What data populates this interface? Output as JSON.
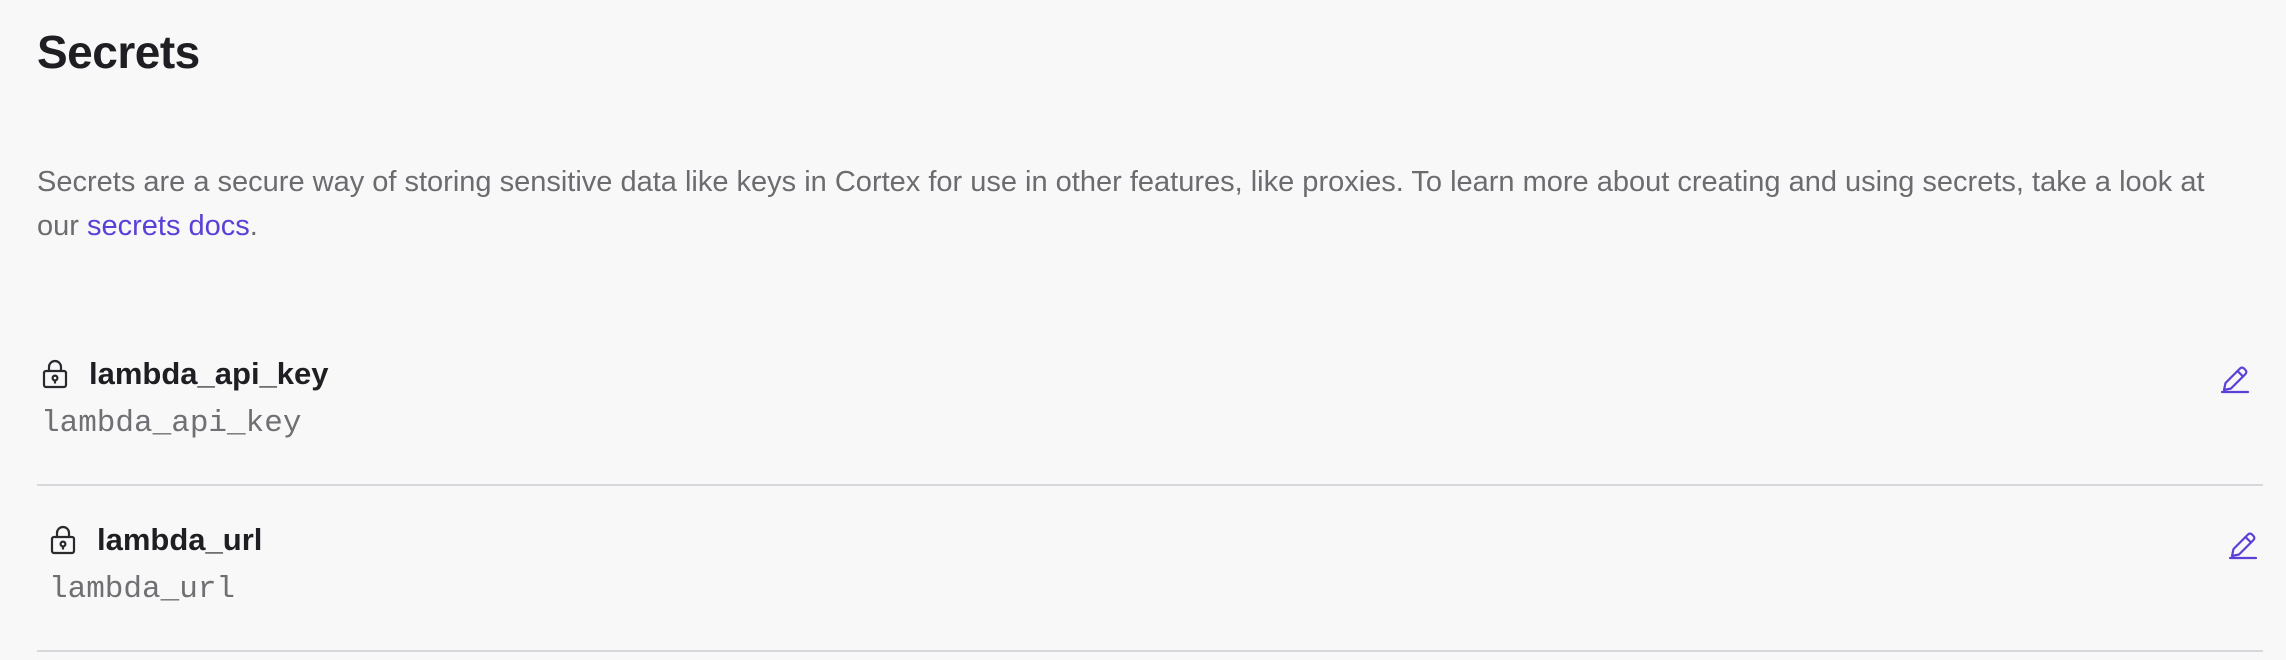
{
  "header": {
    "title": "Secrets"
  },
  "intro": {
    "text_before_link": "Secrets are a secure way of storing sensitive data like keys in Cortex for use in other features, like proxies. To learn more about creating and using secrets, take a look at our ",
    "link_text": "secrets docs",
    "text_after_link": "."
  },
  "secrets": [
    {
      "name": "lambda_api_key",
      "key": "lambda_api_key",
      "icon": "lock-icon",
      "action_icon": "pencil-icon"
    },
    {
      "name": "lambda_url",
      "key": "lambda_url",
      "icon": "lock-icon",
      "action_icon": "pencil-icon"
    }
  ],
  "colors": {
    "accent": "#5b3fd6",
    "text": "#1f1f23",
    "muted": "#6c6c70",
    "divider": "#d8d8dc",
    "background": "#f8f8f8"
  }
}
